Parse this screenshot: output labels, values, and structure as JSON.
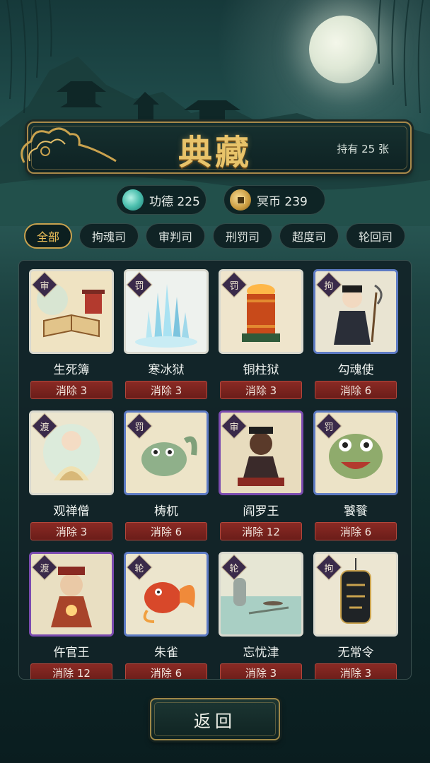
{
  "header": {
    "title": "典藏",
    "owned": "持有 25 张"
  },
  "currencies": [
    {
      "label": "功德 225",
      "icon": "jade-orb-icon"
    },
    {
      "label": "冥币 239",
      "icon": "coin-icon"
    }
  ],
  "tabs": [
    {
      "label": "全部",
      "active": true
    },
    {
      "label": "拘魂司",
      "active": false
    },
    {
      "label": "审判司",
      "active": false
    },
    {
      "label": "刑罚司",
      "active": false
    },
    {
      "label": "超度司",
      "active": false
    },
    {
      "label": "轮回司",
      "active": false
    }
  ],
  "cards": [
    {
      "name": "生死簿",
      "badge": "审",
      "clear": "消除 3",
      "rarity": "common",
      "art": "book"
    },
    {
      "name": "寒冰狱",
      "badge": "罚",
      "clear": "消除 3",
      "rarity": "common",
      "art": "ice"
    },
    {
      "name": "铜柱狱",
      "badge": "罚",
      "clear": "消除 3",
      "rarity": "common",
      "art": "pillar"
    },
    {
      "name": "勾魂使",
      "badge": "拘",
      "clear": "消除 6",
      "rarity": "rare",
      "art": "reaper"
    },
    {
      "name": "观禅僧",
      "badge": "渡",
      "clear": "消除 3",
      "rarity": "common",
      "art": "monk"
    },
    {
      "name": "梼杌",
      "badge": "罚",
      "clear": "消除 6",
      "rarity": "rare",
      "art": "beast"
    },
    {
      "name": "阎罗王",
      "badge": "审",
      "clear": "消除 12",
      "rarity": "epic",
      "art": "king"
    },
    {
      "name": "饕餮",
      "badge": "罚",
      "clear": "消除 6",
      "rarity": "rare",
      "art": "taotie"
    },
    {
      "name": "仵官王",
      "badge": "渡",
      "clear": "消除 12",
      "rarity": "epic",
      "art": "official"
    },
    {
      "name": "朱雀",
      "badge": "轮",
      "clear": "消除 6",
      "rarity": "rare",
      "art": "bird"
    },
    {
      "name": "忘忧津",
      "badge": "轮",
      "clear": "消除 3",
      "rarity": "common",
      "art": "river"
    },
    {
      "name": "无常令",
      "badge": "拘",
      "clear": "消除 3",
      "rarity": "common",
      "art": "token"
    }
  ],
  "back_button": "返回",
  "colors": {
    "gold": "#e8c36a",
    "clear_button": "#7a2420",
    "rare_border": "#5e7bc4",
    "epic_border": "#7b4bb0"
  }
}
